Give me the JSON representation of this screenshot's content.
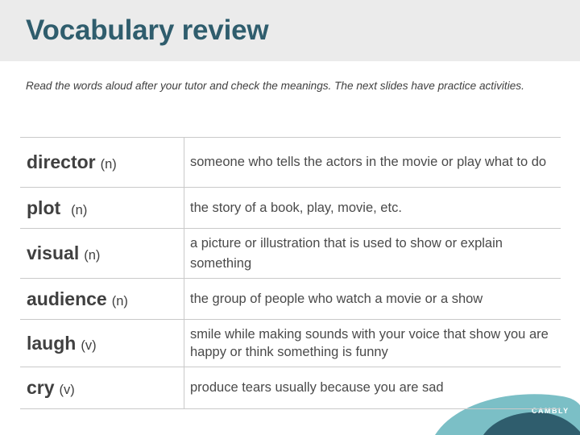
{
  "title": "Vocabulary review",
  "instructions": "Read the words aloud after your tutor and check the meanings. The next slides have practice activities.",
  "vocabulary": [
    {
      "word": "director",
      "pos": "(n)",
      "definition": "someone who tells the actors in the movie or play what to do"
    },
    {
      "word": "plot",
      "pos": "(n)",
      "definition": "the story of a book, play, movie, etc."
    },
    {
      "word": "visual",
      "pos": "(n)",
      "definition": "a picture or illustration that is used to show or explain something"
    },
    {
      "word": "audience",
      "pos": "(n)",
      "definition": "the group of people who watch a movie or a show"
    },
    {
      "word": "laugh",
      "pos": "(v)",
      "definition": "smile while making sounds with your voice that show you are happy or think something is funny"
    },
    {
      "word": "cry",
      "pos": "(v)",
      "definition": "produce tears usually because you are sad"
    }
  ],
  "brand": "CAMBLY",
  "colors": {
    "title": "#2f5d6d",
    "header_bg": "#ebebeb",
    "teal_light": "#7bbfc6",
    "teal_dark": "#2f5d6d"
  }
}
